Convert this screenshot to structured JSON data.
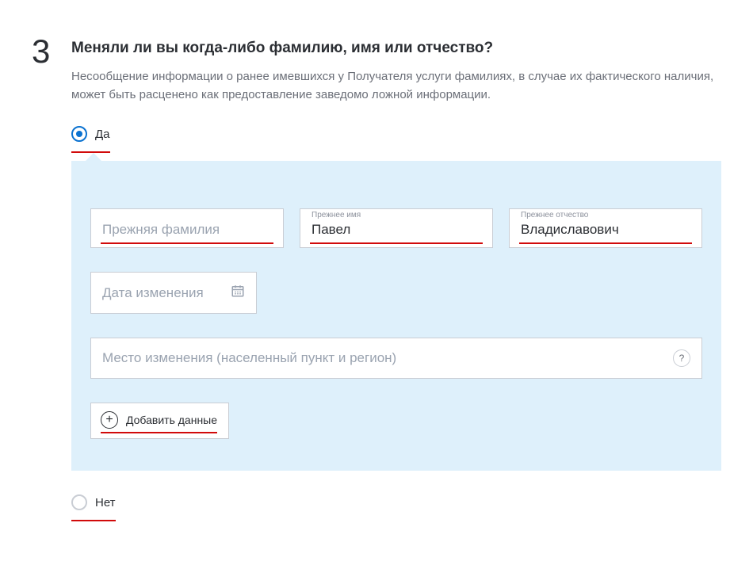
{
  "step_number": "3",
  "title": "Меняли ли вы когда-либо фамилию, имя или отчество?",
  "description": "Несообщение информации о ранее имевшихся у Получателя услуги фамилиях, в случае их фактического наличия, может быть расценено как предоставление заведомо ложной информации.",
  "radio_yes": "Да",
  "radio_no": "Нет",
  "fields": {
    "surname": {
      "placeholder": "Прежняя фамилия",
      "value": ""
    },
    "firstname": {
      "float": "Прежнее имя",
      "value": "Павел"
    },
    "patronymic": {
      "float": "Прежнее отчество",
      "value": "Владиславович"
    },
    "date": {
      "placeholder": "Дата изменения"
    },
    "place": {
      "placeholder": "Место изменения (населенный пункт и регион)"
    }
  },
  "add_button": "Добавить данные",
  "help_symbol": "?"
}
